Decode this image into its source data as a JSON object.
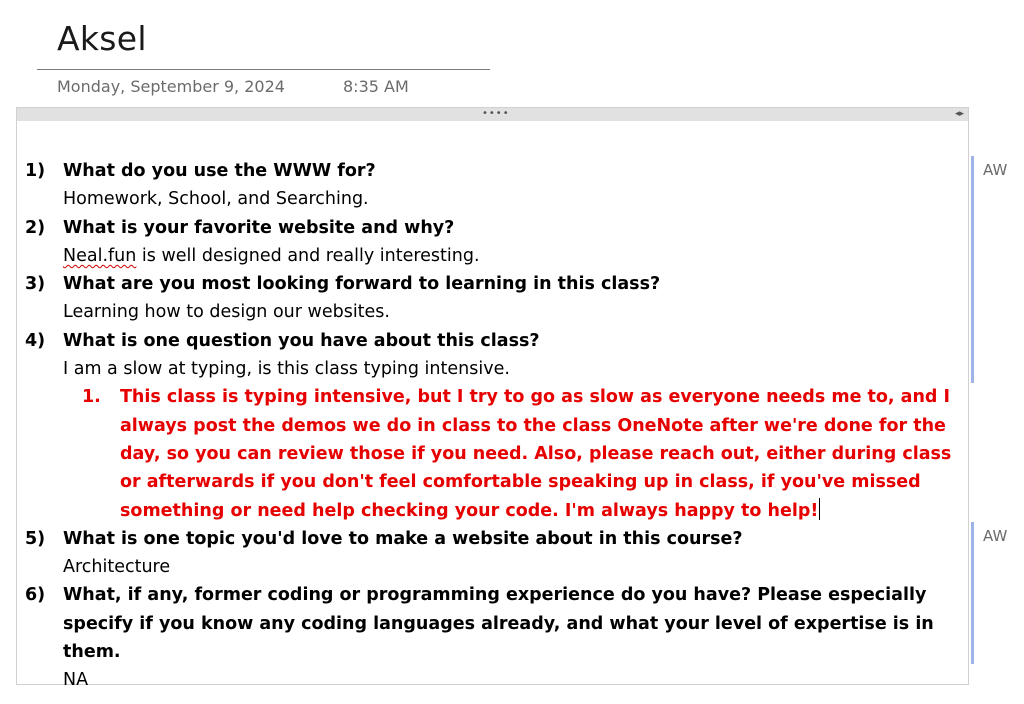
{
  "page": {
    "title": "Aksel",
    "date": "Monday, September 9, 2024",
    "time": "8:35 AM"
  },
  "container": {
    "grip": "••••",
    "resize_arrows": "◂▸"
  },
  "questions": [
    {
      "num": "1)",
      "question": "What do you use the WWW for?",
      "answer": "Homework, School, and Searching."
    },
    {
      "num": "2)",
      "question": "What is your favorite website and why?",
      "answer_word": "Neal.fun",
      "answer_rest": " is well designed and really interesting."
    },
    {
      "num": "3)",
      "question": "What are you most looking forward to learning in this class?",
      "answer": "Learning how to design our websites."
    },
    {
      "num": "4)",
      "question": "What is one question you have about this class?",
      "answer": "I am a slow at typing, is this class typing intensive.",
      "reply": {
        "num": "1.",
        "text": "This class is typing intensive, but I try to go as slow as everyone needs me to, and I always post the demos we do in class to the class OneNote after we're done for the day, so you can review those if you need. Also, please reach out, either during class or afterwards if you don't feel comfortable speaking up in class, if you've missed something or need help checking your code. I'm always happy to help!"
      }
    },
    {
      "num": "5)",
      "question": "What is one topic you'd love to make a website about in this course?",
      "answer": "Architecture"
    },
    {
      "num": "6)",
      "question": "What, if any, former coding or programming experience do you have? Please especially specify if you know any coding languages already, and what your level of expertise is in them.",
      "answer": "NA"
    }
  ],
  "authors": [
    {
      "initials": "AW"
    },
    {
      "initials": "AW"
    }
  ],
  "colors": {
    "reply_text": "#e60000",
    "author_bar": "#9fb3e6"
  }
}
